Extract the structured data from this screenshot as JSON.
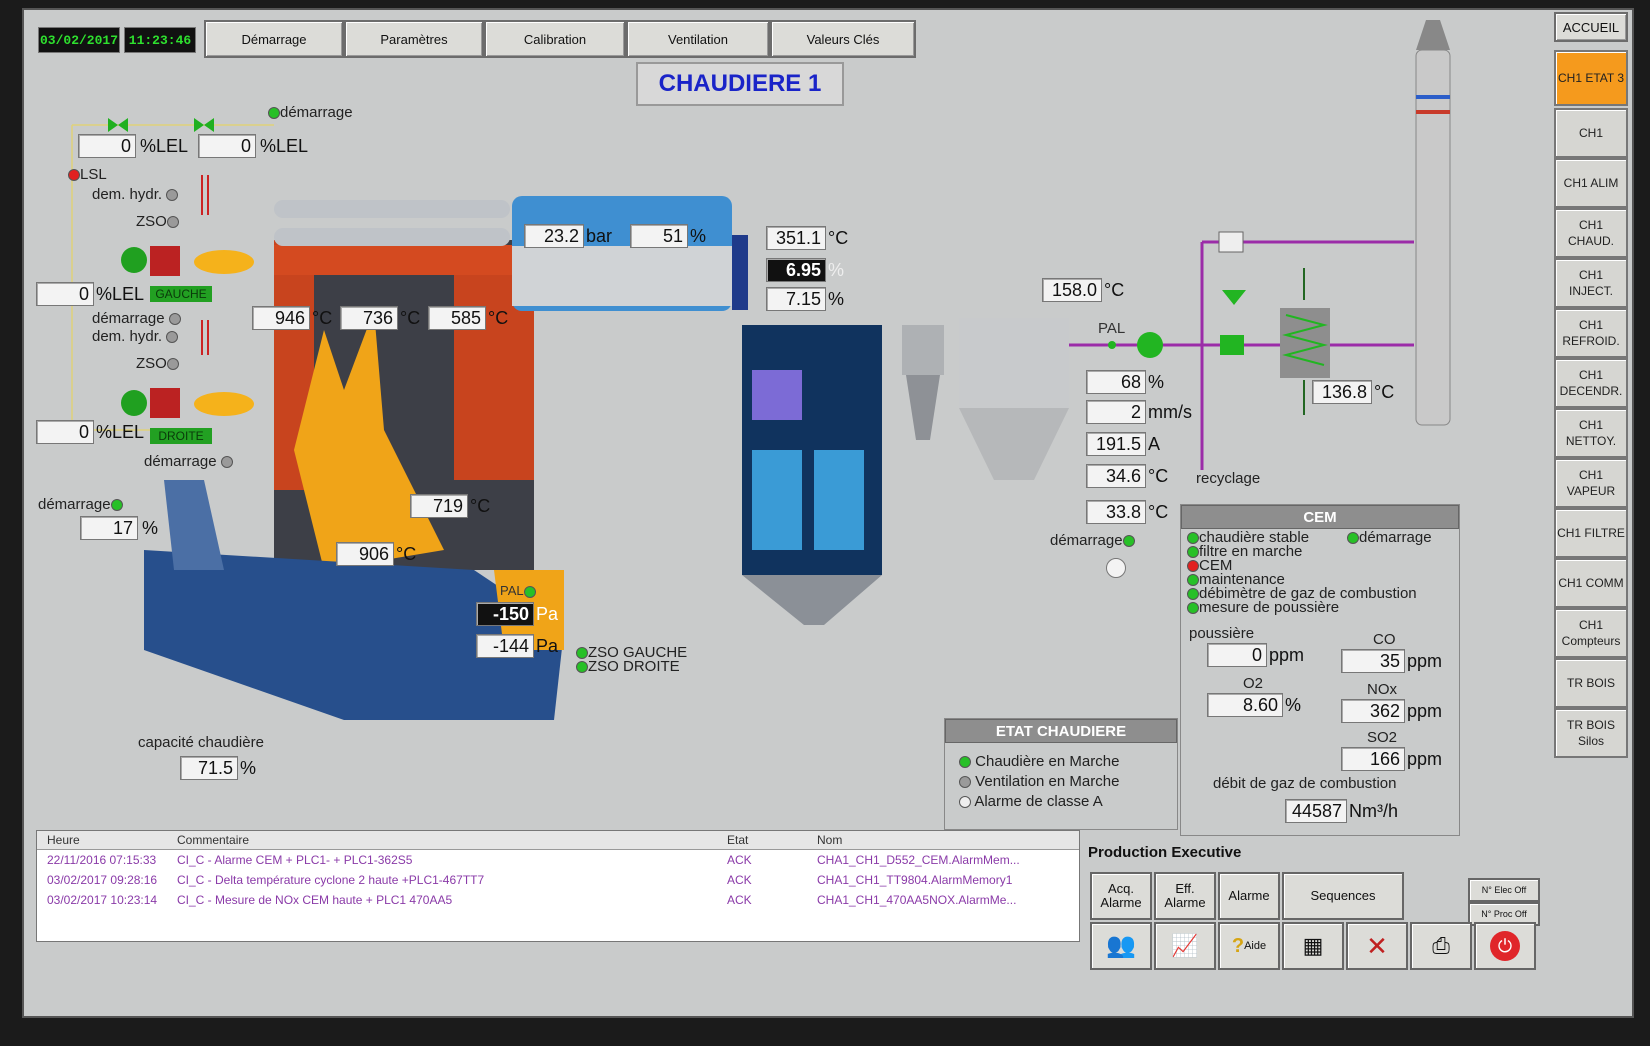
{
  "header": {
    "date": "03/02/2017",
    "time": "11:23:46",
    "title": "CHAUDIERE 1"
  },
  "topmenu": [
    {
      "label": "Démarrage"
    },
    {
      "label": "Paramètres"
    },
    {
      "label": "Calibration"
    },
    {
      "label": "Ventilation"
    },
    {
      "label": "Valeurs Clés"
    }
  ],
  "accueil": "ACCUEIL",
  "sidemenu": [
    {
      "label": "CH1 ETAT 3"
    },
    {
      "label": "CH1"
    },
    {
      "label": "CH1 ALIM"
    },
    {
      "label": "CH1 CHAUD."
    },
    {
      "label": "CH1 INJECT."
    },
    {
      "label": "CH1 REFROID."
    },
    {
      "label": "CH1 DECENDR."
    },
    {
      "label": "CH1 NETTOY."
    },
    {
      "label": "CH1 VAPEUR"
    },
    {
      "label": "CH1 FILTRE"
    },
    {
      "label": "CH1 COMM"
    },
    {
      "label": "CH1 Compteurs"
    },
    {
      "label": "TR BOIS"
    },
    {
      "label": "TR BOIS Silos"
    }
  ],
  "burner": {
    "demarrage": "démarrage",
    "lel1": "0",
    "lel2": "0",
    "lel_unit": "%LEL",
    "lsl": "LSL",
    "dem_hydr": "dem. hydr.",
    "zso": "ZSO",
    "lel3": "0",
    "gauche": "GAUCHE",
    "demarrage2": "démarrage",
    "lel4": "0",
    "droite": "DROITE",
    "demarrage3": "démarrage",
    "demarrage4": "démarrage",
    "feed_pct": "17",
    "pct": "%"
  },
  "boiler": {
    "pressure": "23.2",
    "pressure_unit": "bar",
    "level": "51",
    "level_unit": "%",
    "t1": "946",
    "t2": "736",
    "t3": "585",
    "t4": "719",
    "t5": "906",
    "unit_c": "°C",
    "pal": "PAL",
    "p1": "-150",
    "p2": "-144",
    "unit_pa": "Pa",
    "zso_gauche": "ZSO GAUCHE",
    "zso_droite": "ZSO DROITE",
    "capacite_label": "capacité chaudière",
    "capacite": "71.5",
    "capacite_unit": "%"
  },
  "flue": {
    "t_out": "351.1",
    "o2_a": "6.95",
    "o2_b": "7.15",
    "pct": "%",
    "t_filter": "158.0",
    "pal": "PAL",
    "fan_pct": "68",
    "vib": "2",
    "vib_unit": "mm/s",
    "current": "191.5",
    "current_unit": "A",
    "t_a": "34.6",
    "t_b": "33.8",
    "demarrage": "démarrage",
    "recyclage": "recyclage",
    "t_stack": "136.8"
  },
  "etat": {
    "title": "ETAT CHAUDIERE",
    "items": [
      {
        "label": "Chaudière en Marche",
        "state": "green"
      },
      {
        "label": "Ventilation en Marche",
        "state": "gray"
      },
      {
        "label": "Alarme de classe A",
        "state": "white"
      }
    ]
  },
  "cem": {
    "title": "CEM",
    "status": [
      {
        "label": "chaudière stable",
        "state": "green"
      },
      {
        "label": "filtre en marche",
        "state": "green"
      },
      {
        "label": "CEM",
        "state": "red"
      },
      {
        "label": "maintenance",
        "state": "green"
      },
      {
        "label": "débimètre de gaz de combustion",
        "state": "green"
      },
      {
        "label": "mesure de poussière",
        "state": "green"
      }
    ],
    "demarrage": "démarrage",
    "poussiere_label": "poussière",
    "poussiere": "0",
    "ppm": "ppm",
    "co_label": "CO",
    "co": "35",
    "o2_label": "O2",
    "o2": "8.60",
    "o2_unit": "%",
    "nox_label": "NOx",
    "nox": "362",
    "so2_label": "SO2",
    "so2": "166",
    "debit_label": "débit de gaz de combustion",
    "debit": "44587",
    "debit_unit": "Nm³/h"
  },
  "alarms": {
    "headers": {
      "heure": "Heure",
      "commentaire": "Commentaire",
      "etat": "Etat",
      "nom": "Nom"
    },
    "rows": [
      {
        "heure": "22/11/2016 07:15:33",
        "commentaire": "CI_C - Alarme CEM + PLC1- + PLC1-362S5",
        "etat": "ACK",
        "nom": "CHA1_CH1_D552_CEM.AlarmMem..."
      },
      {
        "heure": "03/02/2017 09:28:16",
        "commentaire": "CI_C - Delta température cyclone 2 haute +PLC1-467TT7",
        "etat": "ACK",
        "nom": "CHA1_CH1_TT9804.AlarmMemory1"
      },
      {
        "heure": "03/02/2017 10:23:14",
        "commentaire": "CI_C - Mesure de NOx CEM haute + PLC1 470AA5",
        "etat": "ACK",
        "nom": "CHA1_CH1_470AA5NOX.AlarmMe..."
      }
    ]
  },
  "prod": {
    "title": "Production Executive",
    "acq": "Acq. Alarme",
    "eff": "Eff. Alarme",
    "alarme": "Alarme",
    "sequences": "Sequences",
    "elec": "N° Elec Off",
    "proc": "N° Proc Off",
    "aide": "Aide"
  }
}
